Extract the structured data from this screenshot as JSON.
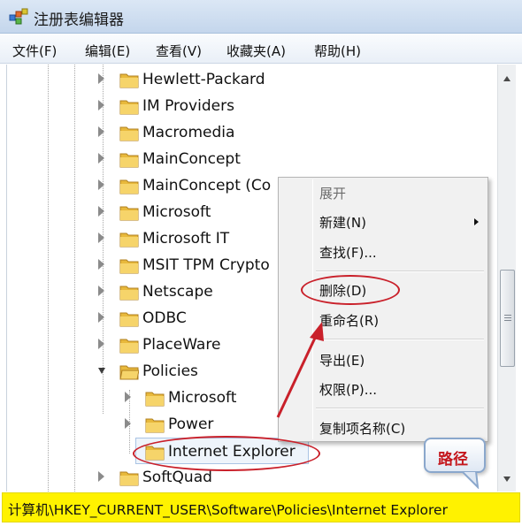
{
  "window": {
    "title": "注册表编辑器"
  },
  "menubar": {
    "items": [
      {
        "label": "文件(F)"
      },
      {
        "label": "编辑(E)"
      },
      {
        "label": "查看(V)"
      },
      {
        "label": "收藏夹(A)"
      },
      {
        "label": "帮助(H)"
      }
    ]
  },
  "tree": {
    "nodes": [
      {
        "label": "Hewlett-Packard",
        "level": 1,
        "state": "collapsed"
      },
      {
        "label": "IM Providers",
        "level": 1,
        "state": "collapsed"
      },
      {
        "label": "Macromedia",
        "level": 1,
        "state": "collapsed"
      },
      {
        "label": "MainConcept",
        "level": 1,
        "state": "collapsed"
      },
      {
        "label": "MainConcept (Co",
        "level": 1,
        "state": "collapsed"
      },
      {
        "label": "Microsoft",
        "level": 1,
        "state": "collapsed"
      },
      {
        "label": "Microsoft IT",
        "level": 1,
        "state": "collapsed"
      },
      {
        "label": "MSIT TPM Crypto",
        "level": 1,
        "state": "collapsed"
      },
      {
        "label": "Netscape",
        "level": 1,
        "state": "collapsed"
      },
      {
        "label": "ODBC",
        "level": 1,
        "state": "collapsed"
      },
      {
        "label": "PlaceWare",
        "level": 1,
        "state": "collapsed"
      },
      {
        "label": "Policies",
        "level": 1,
        "state": "expanded"
      },
      {
        "label": "Microsoft",
        "level": 2,
        "state": "collapsed"
      },
      {
        "label": "Power",
        "level": 2,
        "state": "collapsed"
      },
      {
        "label": "Internet Explorer",
        "level": 2,
        "state": "selected"
      },
      {
        "label": "SoftQuad",
        "level": 1,
        "state": "collapsed"
      }
    ]
  },
  "context_menu": {
    "items": [
      {
        "label": "展开",
        "disabled": true
      },
      {
        "label": "新建(N)",
        "submenu": true
      },
      {
        "label": "查找(F)..."
      },
      {
        "label": "删除(D)"
      },
      {
        "label": "重命名(R)"
      },
      {
        "label": "导出(E)"
      },
      {
        "label": "权限(P)..."
      },
      {
        "label": "复制项名称(C)"
      }
    ]
  },
  "annotation": {
    "callout_label": "路径",
    "color": "#c9202a"
  },
  "statusbar": {
    "path": "计算机\\HKEY_CURRENT_USER\\Software\\Policies\\Internet Explorer",
    "highlight_color": "#fff200"
  }
}
